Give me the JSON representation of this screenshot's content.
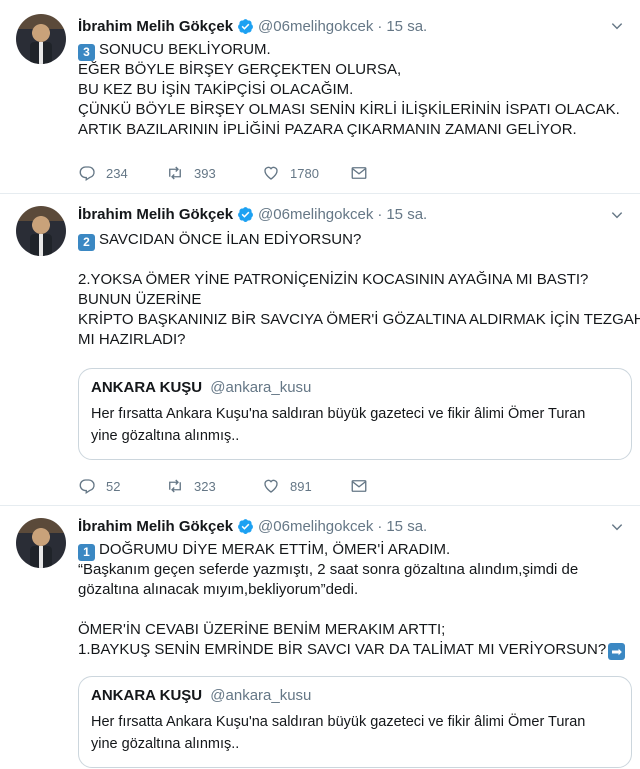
{
  "tweets": [
    {
      "author": {
        "name": "İbrahim Melih Gökçek",
        "handle": "@06melihgokcek",
        "time": "15 sa."
      },
      "keycap": "3",
      "lines": [
        "SONUCU BEKLİYORUM.",
        "EĞER BÖYLE BİRŞEY GERÇEKTEN OLURSA,",
        "BU KEZ BU İŞİN TAKİPÇİSİ OLACAĞIM.",
        "ÇÜNKÜ BÖYLE BİRŞEY OLMASI SENİN KİRLİ İLİŞKİLERİNİN İSPATI OLACAK.",
        "ARTIK BAZILARININ İPLİĞİNİ PAZARA ÇIKARMANIN ZAMANI GELİYOR."
      ],
      "stats": {
        "replies": "234",
        "retweets": "393",
        "likes": "1780"
      }
    },
    {
      "author": {
        "name": "İbrahim Melih Gökçek",
        "handle": "@06melihgokcek",
        "time": "15 sa."
      },
      "keycap": "2",
      "lines": [
        "SAVCIDAN ÖNCE İLAN EDİYORSUN?",
        "",
        "2.YOKSA ÖMER YİNE PATRONİÇENİZİN KOCASININ AYAĞINA MI BASTI?",
        "BUNUN ÜZERİNE",
        "KRİPTO BAŞKANINIZ BİR SAVCIYA ÖMER'İ GÖZALTINA ALDIRMAK İÇİN TEZGAH",
        "MI HAZIRLADI?"
      ],
      "quote": {
        "name": "ANKARA KUŞU",
        "handle": "@ankara_kusu",
        "lines": [
          "Her fırsatta Ankara Kuşu'na saldıran büyük gazeteci ve fikir âlimi Ömer Turan",
          "yine gözaltına alınmış.."
        ]
      },
      "stats": {
        "replies": "52",
        "retweets": "323",
        "likes": "891"
      }
    },
    {
      "author": {
        "name": "İbrahim Melih Gökçek",
        "handle": "@06melihgokcek",
        "time": "15 sa."
      },
      "keycap": "1",
      "lines": [
        "DOĞRUMU DİYE MERAK ETTİM, ÖMER'İ ARADIM.",
        "“Başkanım geçen seferde yazmıştı, 2 saat sonra gözaltına alındım,şimdi de",
        "gözaltına alınacak mıyım,bekliyorum”dedi.",
        "",
        "ÖMER'İN CEVABI ÜZERİNE BENİM MERAKIM ARTTI;",
        "1.BAYKUŞ SENİN EMRİNDE BİR SAVCI VAR DA TALİMAT MI VERİYORSUN?"
      ],
      "arrow": "➡",
      "quote": {
        "name": "ANKARA KUŞU",
        "handle": "@ankara_kusu",
        "lines": [
          "Her fırsatta Ankara Kuşu'na saldıran büyük gazeteci ve fikir âlimi Ömer Turan",
          "yine gözaltına alınmış.."
        ]
      }
    }
  ],
  "icons": {
    "verified": "verified-badge-icon",
    "caret": "chevron-down-icon",
    "reply": "reply-icon",
    "retweet": "retweet-icon",
    "like": "heart-icon",
    "dm": "envelope-icon"
  },
  "colors": {
    "verified": "#1da1f2",
    "muted": "#657786",
    "keycap": "#3b88c3",
    "border": "#e6ecf0"
  }
}
